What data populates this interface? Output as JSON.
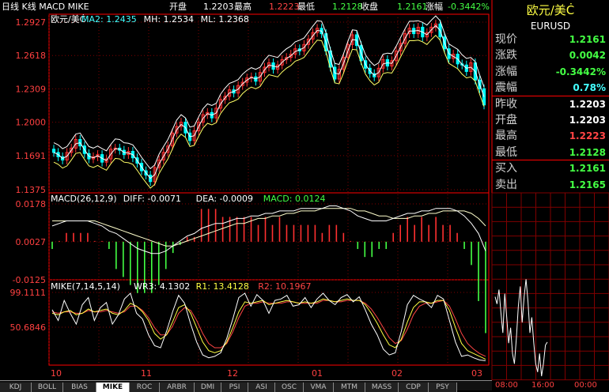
{
  "header": {
    "title": "日线 K线 MACD MIKE",
    "open_label": "开盘",
    "open": "1.2203",
    "high_label": "最高",
    "high": "1.2223",
    "low_label": "最低",
    "low": "1.2128",
    "close_label": "收盘",
    "close": "1.2161",
    "change_label": "涨幅",
    "change": "-0.3442%"
  },
  "sidebar": {
    "title": "欧元/美Ċ",
    "code": "EURUSD",
    "quotes": [
      {
        "label": "现价",
        "value": "1.2161",
        "color": "#44ff44"
      },
      {
        "label": "涨跌",
        "value": "0.0042",
        "color": "#44ff44"
      },
      {
        "label": "涨幅",
        "value": "-0.3442%",
        "color": "#44ff44"
      },
      {
        "label": "震幅",
        "value": "0.78%",
        "color": "#44ffff"
      },
      {
        "label": "昨收",
        "value": "1.2203",
        "color": "#ffffff"
      },
      {
        "label": "开盘",
        "value": "1.2203",
        "color": "#ffffff"
      },
      {
        "label": "最高",
        "value": "1.2223",
        "color": "#ff4444"
      },
      {
        "label": "最低",
        "value": "1.2128",
        "color": "#44ff44"
      },
      {
        "label": "买入",
        "value": "1.2161",
        "color": "#44ff44"
      },
      {
        "label": "卖出",
        "value": "1.2165",
        "color": "#44ff44"
      }
    ],
    "intraday_times": [
      "08:00",
      "16:00",
      "00:00"
    ]
  },
  "tabs": [
    "KDJ",
    "BOLL",
    "BIAS",
    "MIKE",
    "ROC",
    "ARBR",
    "DMI",
    "PSI",
    "ASI",
    "OSC",
    "VMA",
    "MTM",
    "MASS",
    "CDP",
    "PSY"
  ],
  "active_tab": "MIKE",
  "colors": {
    "up": "#ff3030",
    "down": "#00ffff",
    "grid": "#800000",
    "axis": "#ff0000",
    "label": "#ff4040"
  },
  "chart_data": [
    {
      "type": "candlestick",
      "legend": [
        {
          "text": "欧元/美Ċ",
          "color": "#ffffff"
        },
        {
          "text": "MA2: 1.2435",
          "color": "#44ffff"
        },
        {
          "text": "MH: 1.2534",
          "color": "#ffffff"
        },
        {
          "text": "ML: 1.2368",
          "color": "#ffffff"
        }
      ],
      "yticks": [
        "1.2927",
        "1.2618",
        "1.2309",
        "1.2000",
        "1.1691",
        "1.1375"
      ],
      "ylim": [
        1.1375,
        1.2927
      ],
      "xticks": [
        "10",
        "11",
        "12",
        "01",
        "02",
        "03"
      ],
      "close": [
        1.172,
        1.168,
        1.165,
        1.172,
        1.176,
        1.184,
        1.178,
        1.171,
        1.166,
        1.168,
        1.17,
        1.163,
        1.166,
        1.175,
        1.176,
        1.174,
        1.17,
        1.173,
        1.167,
        1.162,
        1.155,
        1.151,
        1.145,
        1.158,
        1.165,
        1.172,
        1.178,
        1.19,
        1.196,
        1.2,
        1.19,
        1.183,
        1.192,
        1.2,
        1.207,
        1.209,
        1.204,
        1.213,
        1.221,
        1.224,
        1.23,
        1.227,
        1.234,
        1.237,
        1.241,
        1.242,
        1.238,
        1.246,
        1.251,
        1.255,
        1.249,
        1.253,
        1.258,
        1.26,
        1.263,
        1.268,
        1.266,
        1.272,
        1.277,
        1.283,
        1.287,
        1.282,
        1.266,
        1.251,
        1.24,
        1.249,
        1.26,
        1.272,
        1.281,
        1.271,
        1.257,
        1.25,
        1.245,
        1.242,
        1.25,
        1.258,
        1.252,
        1.257,
        1.266,
        1.273,
        1.282,
        1.287,
        1.282,
        1.288,
        1.279,
        1.283,
        1.288,
        1.291,
        1.279,
        1.268,
        1.259,
        1.263,
        1.254,
        1.253,
        1.247,
        1.255,
        1.239,
        1.231,
        1.216
      ],
      "series": [
        {
          "name": "MA2",
          "color": "#ffffff"
        },
        {
          "name": "MH",
          "color": "#ffffff"
        },
        {
          "name": "ML",
          "color": "#ffff66"
        }
      ]
    },
    {
      "type": "macd",
      "legend": [
        {
          "text": "MACD(26,12,9)",
          "color": "#ffffff"
        },
        {
          "text": "DIFF: -0.0071",
          "color": "#ffffff"
        },
        {
          "text": "DEA: -0.0009",
          "color": "#ffffff"
        },
        {
          "text": "MACD: 0.0124",
          "color": "#44ff44"
        }
      ],
      "yticks": [
        "0.0178",
        "0.0027",
        "-0.0125"
      ],
      "ylim": [
        -0.0125,
        0.0178
      ],
      "zero_value": 0.0027,
      "diff": [
        0.009,
        0.01,
        0.011,
        0.011,
        0.011,
        0.011,
        0.01,
        0.009,
        0.007,
        0.006,
        0.004,
        0.002,
        0.0,
        -0.001,
        -0.002,
        -0.002,
        -0.001,
        0.001,
        0.003,
        0.005,
        0.006,
        0.008,
        0.009,
        0.01,
        0.01,
        0.011,
        0.012,
        0.012,
        0.013,
        0.013,
        0.014,
        0.014,
        0.015,
        0.015,
        0.015,
        0.016,
        0.016,
        0.016,
        0.016,
        0.017,
        0.017,
        0.016,
        0.015,
        0.013,
        0.012,
        0.011,
        0.011,
        0.011,
        0.012,
        0.013,
        0.014,
        0.014,
        0.015,
        0.015,
        0.016,
        0.016,
        0.016,
        0.015,
        0.013,
        0.01,
        0.006,
        -0.001
      ],
      "dea": [
        0.011,
        0.011,
        0.011,
        0.011,
        0.011,
        0.011,
        0.011,
        0.01,
        0.009,
        0.008,
        0.007,
        0.006,
        0.005,
        0.004,
        0.003,
        0.002,
        0.001,
        0.001,
        0.002,
        0.003,
        0.004,
        0.005,
        0.006,
        0.007,
        0.008,
        0.009,
        0.01,
        0.01,
        0.011,
        0.012,
        0.012,
        0.013,
        0.013,
        0.014,
        0.014,
        0.015,
        0.015,
        0.015,
        0.016,
        0.016,
        0.016,
        0.016,
        0.016,
        0.015,
        0.015,
        0.014,
        0.013,
        0.013,
        0.012,
        0.012,
        0.012,
        0.013,
        0.013,
        0.014,
        0.014,
        0.015,
        0.015,
        0.015,
        0.015,
        0.014,
        0.012,
        0.009
      ],
      "series": [
        {
          "name": "DIFF",
          "color": "#ffffff"
        },
        {
          "name": "DEA",
          "color": "#ffffcc"
        },
        {
          "name": "MACD",
          "color": "#44ff44"
        }
      ]
    },
    {
      "type": "line",
      "legend": [
        {
          "text": "MIKE(7,14,5,14)",
          "color": "#ffffff"
        },
        {
          "text": "WR3: 4.1302",
          "color": "#ffffff"
        },
        {
          "text": "R1: 13.4128",
          "color": "#ffff44"
        },
        {
          "text": "R2: 10.1967",
          "color": "#ff4444"
        }
      ],
      "yticks": [
        "99.1111",
        "50.6846"
      ],
      "ylim": [
        0,
        99.1111
      ],
      "series": [
        {
          "name": "WR3",
          "color": "#ffffff",
          "values": [
            75,
            60,
            88,
            70,
            55,
            82,
            92,
            60,
            78,
            85,
            55,
            68,
            90,
            98,
            70,
            62,
            40,
            25,
            22,
            45,
            72,
            95,
            84,
            55,
            30,
            12,
            8,
            10,
            15,
            35,
            62,
            92,
            98,
            80,
            96,
            88,
            70,
            88,
            90,
            95,
            80,
            82,
            92,
            78,
            90,
            98,
            88,
            82,
            92,
            96,
            86,
            93,
            75,
            55,
            40,
            20,
            12,
            15,
            45,
            82,
            95,
            90,
            86,
            78,
            95,
            90,
            60,
            30,
            10,
            12,
            8,
            5,
            4
          ]
        },
        {
          "name": "R1",
          "color": "#ffff44",
          "values": [
            70,
            68,
            72,
            74,
            68,
            70,
            76,
            72,
            74,
            76,
            70,
            68,
            74,
            84,
            80,
            72,
            60,
            42,
            34,
            40,
            58,
            78,
            82,
            70,
            50,
            30,
            18,
            15,
            18,
            30,
            50,
            72,
            86,
            84,
            86,
            88,
            82,
            84,
            86,
            88,
            86,
            84,
            86,
            84,
            86,
            90,
            88,
            86,
            88,
            90,
            88,
            88,
            82,
            70,
            56,
            40,
            26,
            22,
            34,
            58,
            78,
            86,
            86,
            84,
            88,
            88,
            74,
            50,
            28,
            18,
            14,
            10,
            6
          ]
        },
        {
          "name": "R2",
          "color": "#ff4444",
          "values": [
            72,
            70,
            72,
            72,
            70,
            70,
            74,
            72,
            72,
            74,
            72,
            70,
            72,
            80,
            80,
            74,
            64,
            50,
            40,
            40,
            52,
            70,
            78,
            74,
            60,
            42,
            28,
            22,
            22,
            28,
            44,
            64,
            80,
            84,
            84,
            86,
            84,
            84,
            84,
            86,
            86,
            84,
            84,
            84,
            84,
            88,
            88,
            86,
            86,
            88,
            88,
            88,
            84,
            76,
            64,
            50,
            36,
            28,
            32,
            48,
            68,
            80,
            84,
            84,
            86,
            88,
            80,
            62,
            42,
            28,
            20,
            14,
            10
          ]
        }
      ]
    },
    {
      "type": "line",
      "name": "intraday",
      "values": [
        1.2205,
        1.2198,
        1.2212,
        1.219,
        1.217,
        1.2208,
        1.2185,
        1.216,
        1.2175,
        1.215,
        1.214,
        1.2165,
        1.2195,
        1.2215,
        1.218,
        1.2205,
        1.2222,
        1.22,
        1.217,
        1.2185,
        1.216,
        1.214,
        1.2132,
        1.215,
        1.2128,
        1.214,
        1.2158,
        1.2161
      ],
      "ylim": [
        1.2128,
        1.2223
      ]
    }
  ]
}
